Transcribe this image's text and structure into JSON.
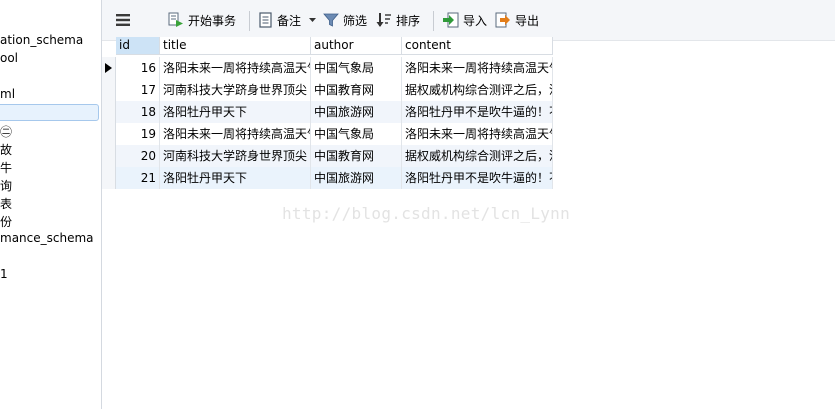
{
  "sidebar": {
    "items": [
      "ation_schema",
      "ool",
      "ml",
      "",
      "㊁",
      "故",
      "牛",
      "询",
      "表",
      "份",
      "mance_schema",
      "1"
    ]
  },
  "toolbar": {
    "begin_transaction": "开始事务",
    "memo": "备注",
    "filter": "筛选",
    "sort": "排序",
    "import": "导入",
    "export": "导出"
  },
  "table": {
    "columns": [
      "id",
      "title",
      "author",
      "content"
    ],
    "rows": [
      {
        "id": "16",
        "title": "洛阳未来一周将持续高温天气",
        "author": "中国气象局",
        "content": "洛阳未来一周将持续高温天气"
      },
      {
        "id": "17",
        "title": "河南科技大学跻身世界顶尖",
        "author": "中国教育网",
        "content": "据权威机构综合测评之后，河"
      },
      {
        "id": "18",
        "title": "洛阳牡丹甲天下",
        "author": "中国旅游网",
        "content": "洛阳牡丹甲不是吹牛逼的！不"
      },
      {
        "id": "19",
        "title": "洛阳未来一周将持续高温天气",
        "author": "中国气象局",
        "content": "洛阳未来一周将持续高温天气"
      },
      {
        "id": "20",
        "title": "河南科技大学跻身世界顶尖",
        "author": "中国教育网",
        "content": "据权威机构综合测评之后，河"
      },
      {
        "id": "21",
        "title": "洛阳牡丹甲天下",
        "author": "中国旅游网",
        "content": "洛阳牡丹甲不是吹牛逼的！不"
      }
    ]
  },
  "watermark": "http://blog.csdn.net/lcn_Lynn"
}
